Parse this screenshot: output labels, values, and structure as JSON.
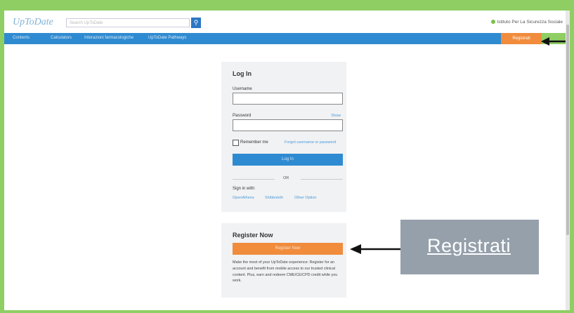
{
  "header": {
    "logo": "UpToDate",
    "search_placeholder": "Search UpToDate",
    "institution": "Istituto Per La Sicurezza Sociale"
  },
  "nav": {
    "items": [
      "Contents",
      "Calculators",
      "Interazioni farmacologiche",
      "UpToDate Pathways"
    ],
    "register_label": "Registrati"
  },
  "login": {
    "title": "Log In",
    "username_label": "Username",
    "password_label": "Password",
    "show_link": "Show",
    "remember_label": "Remember me",
    "forgot_link": "Forgot username or password",
    "login_button": "Log In",
    "or_label": "OR",
    "sign_in_with": "Sign in with:",
    "sso_links": [
      "OpenAthens",
      "Shibboleth",
      "Other Option"
    ]
  },
  "register": {
    "title": "Register Now",
    "button": "Register Now",
    "description": "Make the most of your UpToDate experience: Register for an account and benefit from mobile access to our trusted clinical content. Plus, earn and redeem CME/CE/CPD credit while you work."
  },
  "callout": {
    "text": "Registrati"
  },
  "colors": {
    "frame_green": "#8fce63",
    "nav_blue": "#2f8bd1",
    "register_orange": "#f08c3c",
    "callout_gray": "#95a0ab"
  }
}
